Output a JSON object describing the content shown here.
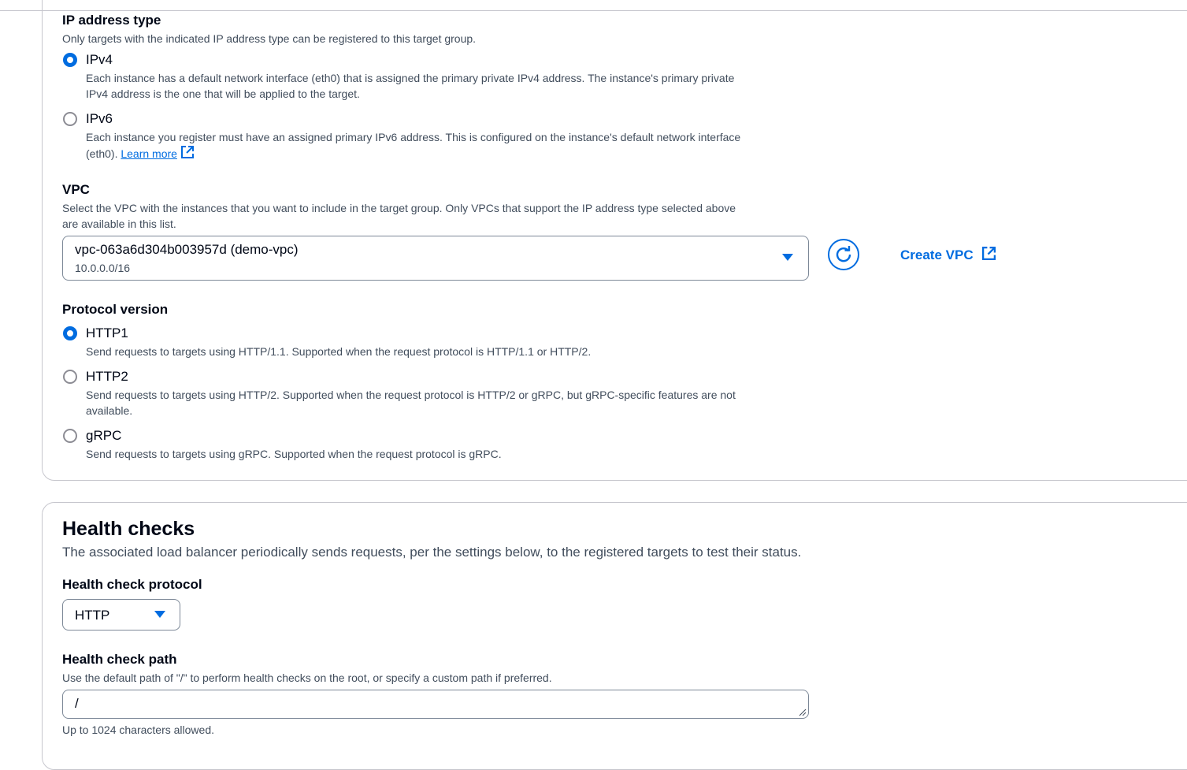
{
  "ip_address_type": {
    "label": "IP address type",
    "description": "Only targets with the indicated IP address type can be registered to this target group.",
    "options": [
      {
        "label": "IPv4",
        "checked": true,
        "desc_line1": "Each instance has a default network interface (eth0) that is assigned the primary private IPv4 address. The instance's primary private",
        "desc_line2": "IPv4 address is the one that will be applied to the target."
      },
      {
        "label": "IPv6",
        "checked": false,
        "desc_line1": "Each instance you register must have an assigned primary IPv6 address. This is configured on the instance's default network interface",
        "desc_line2": "(eth0).",
        "link": "Learn more"
      }
    ]
  },
  "vpc": {
    "label": "VPC",
    "desc_line1": "Select the VPC with the instances that you want to include in the target group. Only VPCs that support the IP address type selected above",
    "desc_line2": "are available in this list.",
    "selected": "vpc-063a6d304b003957d (demo-vpc)",
    "selected_sub": "10.0.0.0/16",
    "create_label": "Create VPC",
    "refresh_icon": "refresh-icon"
  },
  "protocol_version": {
    "label": "Protocol version",
    "options": [
      {
        "label": "HTTP1",
        "checked": true,
        "desc_line1": "Send requests to targets using HTTP/1.1. Supported when the request protocol is HTTP/1.1 or HTTP/2."
      },
      {
        "label": "HTTP2",
        "checked": false,
        "desc_line1": "Send requests to targets using HTTP/2. Supported when the request protocol is HTTP/2 or gRPC, but gRPC-specific features are not",
        "desc_line2": "available."
      },
      {
        "label": "gRPC",
        "checked": false,
        "desc_line1": "Send requests to targets using gRPC. Supported when the request protocol is gRPC."
      }
    ]
  },
  "health_checks": {
    "title": "Health checks",
    "description": "The associated load balancer periodically sends requests, per the settings below, to the registered targets to test their status.",
    "protocol_label": "Health check protocol",
    "protocol_value": "HTTP",
    "path_label": "Health check path",
    "path_description": "Use the default path of \"/\" to perform health checks on the root, or specify a custom path if preferred.",
    "path_value": "/",
    "path_constraint": "Up to 1024 characters allowed."
  },
  "colors": {
    "accent": "#006ce0",
    "text": "#000716",
    "secondary_text": "#414d5c",
    "border": "#c6c6cd"
  }
}
